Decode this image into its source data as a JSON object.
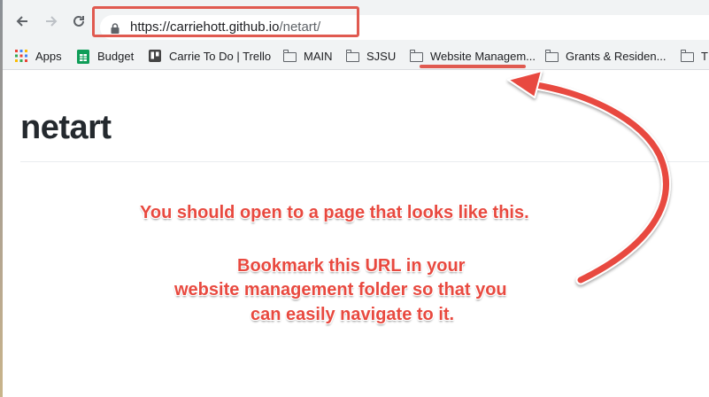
{
  "browser": {
    "url_host": "https://carriehott.github.io",
    "url_path": "/netart/",
    "nav_icons": [
      "back-arrow-icon",
      "forward-arrow-icon",
      "reload-icon"
    ],
    "lock_icon": "lock-icon"
  },
  "bookmarks": [
    {
      "label": "Apps",
      "icon": "apps-grid-icon"
    },
    {
      "label": "Budget",
      "icon": "sheets-icon"
    },
    {
      "label": "Carrie To Do | Trello",
      "icon": "trello-icon"
    },
    {
      "label": "MAIN",
      "icon": "folder-icon"
    },
    {
      "label": "SJSU",
      "icon": "folder-icon"
    },
    {
      "label": "Website Managem...",
      "icon": "folder-icon"
    },
    {
      "label": "Grants & Residen...",
      "icon": "folder-icon"
    },
    {
      "label": "T",
      "icon": "folder-icon"
    }
  ],
  "page": {
    "title": "netart"
  },
  "annotations": {
    "line1": "You should open to a page that looks like this.",
    "line2": "Bookmark this URL in your",
    "line3": "website management folder so that you",
    "line4": "can easily navigate to it."
  },
  "colors": {
    "annotation": "#e8493f",
    "toolbar": "#f1f3f4",
    "title": "#24292e"
  }
}
